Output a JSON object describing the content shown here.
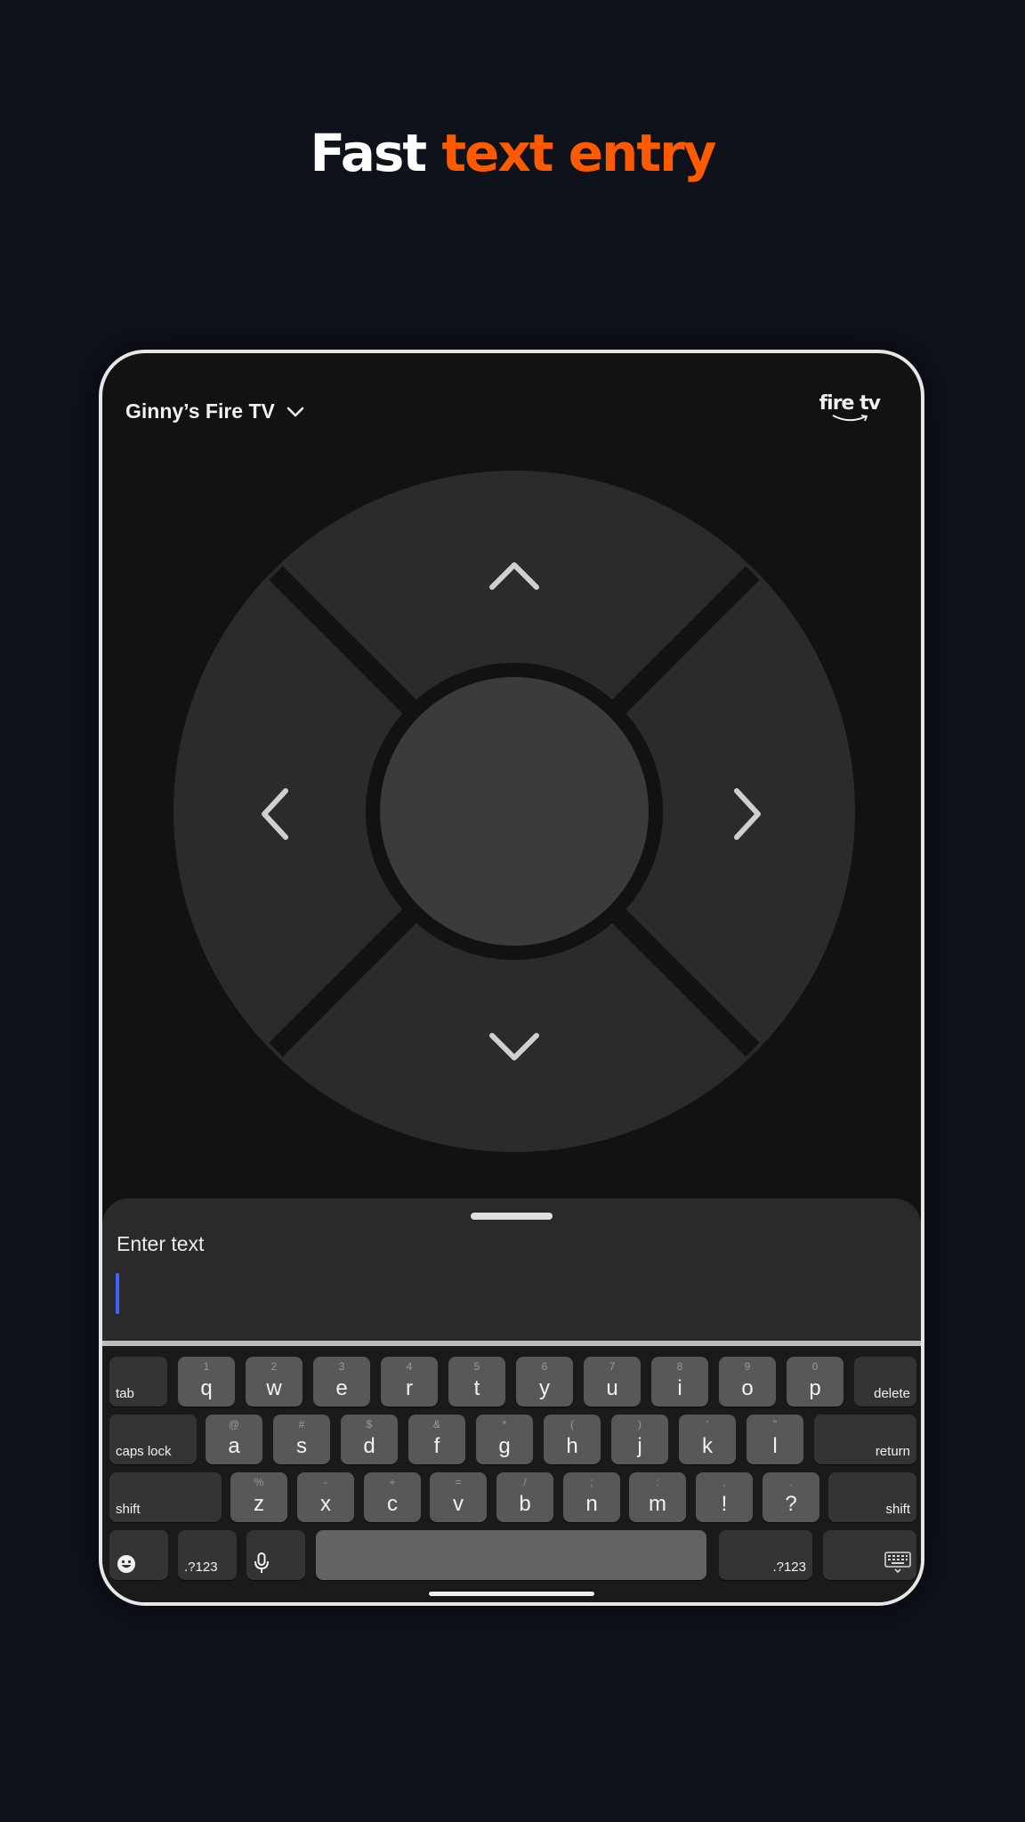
{
  "headline": {
    "part1": "Fast ",
    "part2": "text entry"
  },
  "header": {
    "device_name": "Ginny’s Fire TV",
    "brand": "fire tv"
  },
  "sheet": {
    "title": "Enter text"
  },
  "keyboard": {
    "row1": [
      {
        "main": "q",
        "alt": "1"
      },
      {
        "main": "w",
        "alt": "2"
      },
      {
        "main": "e",
        "alt": "3"
      },
      {
        "main": "r",
        "alt": "4"
      },
      {
        "main": "t",
        "alt": "5"
      },
      {
        "main": "y",
        "alt": "6"
      },
      {
        "main": "u",
        "alt": "7"
      },
      {
        "main": "i",
        "alt": "8"
      },
      {
        "main": "o",
        "alt": "9"
      },
      {
        "main": "p",
        "alt": "0"
      }
    ],
    "row2": [
      {
        "main": "a",
        "alt": "@"
      },
      {
        "main": "s",
        "alt": "#"
      },
      {
        "main": "d",
        "alt": "$"
      },
      {
        "main": "f",
        "alt": "&"
      },
      {
        "main": "g",
        "alt": "*"
      },
      {
        "main": "h",
        "alt": "("
      },
      {
        "main": "j",
        "alt": ")"
      },
      {
        "main": "k",
        "alt": "'"
      },
      {
        "main": "l",
        "alt": "\""
      }
    ],
    "row3": [
      {
        "main": "z",
        "alt": "%"
      },
      {
        "main": "x",
        "alt": "-"
      },
      {
        "main": "c",
        "alt": "+"
      },
      {
        "main": "v",
        "alt": "="
      },
      {
        "main": "b",
        "alt": "/"
      },
      {
        "main": "n",
        "alt": ";"
      },
      {
        "main": "m",
        "alt": ":"
      },
      {
        "main": "!",
        "alt": ","
      },
      {
        "main": "?",
        "alt": "."
      }
    ],
    "tab": "tab",
    "delete": "delete",
    "caps_lock": "caps lock",
    "return": "return",
    "shift": "shift",
    "numbers": ".?123"
  },
  "icons": {
    "dropdown": "chevron-down-icon",
    "up": "chevron-up-icon",
    "down": "chevron-down-icon",
    "left": "chevron-left-icon",
    "right": "chevron-right-icon",
    "emoji": "emoji-icon",
    "mic": "microphone-icon",
    "hide_keyboard": "keyboard-hide-icon"
  },
  "colors": {
    "accent": "#ff5a00",
    "caret": "#3f63ff",
    "background": "#0e121a"
  }
}
